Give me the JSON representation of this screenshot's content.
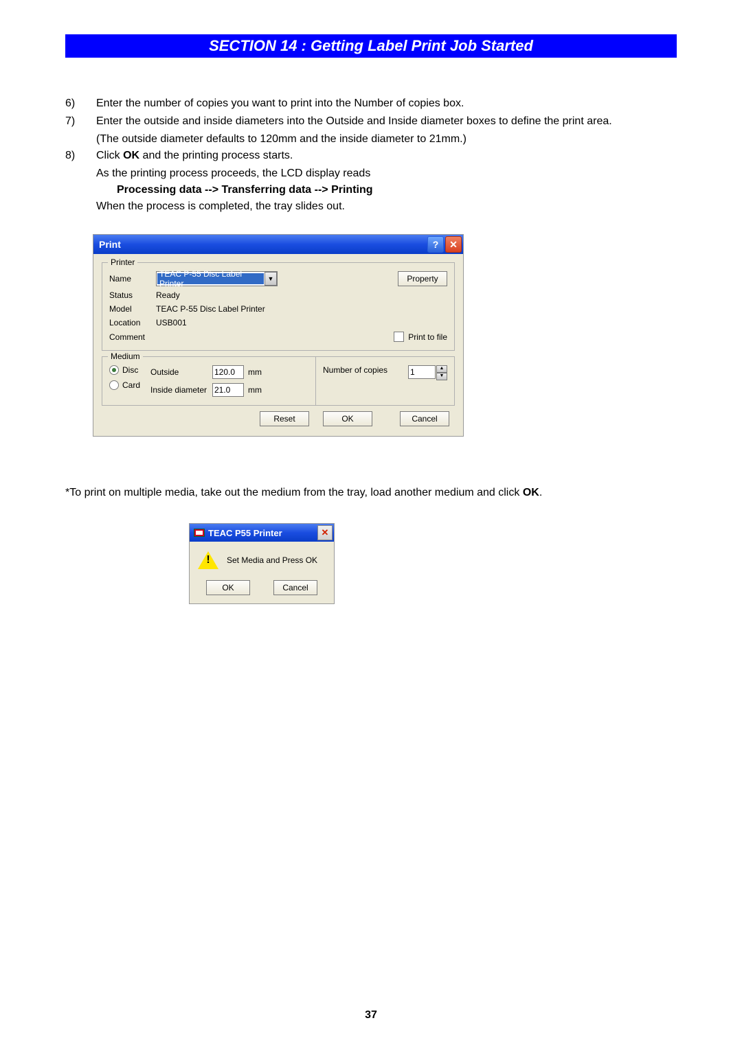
{
  "section_title": "SECTION 14 : Getting Label Print Job Started",
  "steps": {
    "six": {
      "num": "6)",
      "text": "Enter the number of copies you want to print into the Number of copies box."
    },
    "seven": {
      "num": "7)",
      "text": "Enter the outside and inside diameters into the Outside and Inside diameter boxes to define the print area.",
      "sub": "(The outside diameter defaults to 120mm and the inside diameter to 21mm.)"
    },
    "eight": {
      "num": "8)",
      "text_a": "Click ",
      "text_b_bold": "OK",
      "text_c": " and the printing process starts.",
      "sub1": "As the printing process proceeds, the LCD display reads",
      "sub2_bold": "Processing data --> Transferring data --> Printing",
      "sub3": "When the process is completed, the tray slides out."
    }
  },
  "print_dialog": {
    "title": "Print",
    "printer_group": "Printer",
    "name_label": "Name",
    "name_value": "TEAC P-55 Disc Label Printer",
    "property_btn": "Property",
    "status_label": "Status",
    "status_value": "Ready",
    "model_label": "Model",
    "model_value": "TEAC P-55 Disc Label Printer",
    "location_label": "Location",
    "location_value": "USB001",
    "comment_label": "Comment",
    "print_to_file": "Print to file",
    "medium_group": "Medium",
    "disc_label": "Disc",
    "card_label": "Card",
    "outside_label": "Outside",
    "outside_value": "120.0",
    "inside_label": "Inside diameter",
    "inside_value": "21.0",
    "unit": "mm",
    "copies_label": "Number of copies",
    "copies_value": "1",
    "reset_btn": "Reset",
    "ok_btn": "OK",
    "cancel_btn": "Cancel"
  },
  "note": {
    "text_a": "*To print on multiple media, take out the medium from the tray, load another medium and click ",
    "text_b_bold": "OK",
    "text_c": "."
  },
  "msg_dialog": {
    "title": "TEAC P55 Printer",
    "message": "Set Media and Press OK",
    "ok_btn": "OK",
    "cancel_btn": "Cancel"
  },
  "page_number": "37"
}
